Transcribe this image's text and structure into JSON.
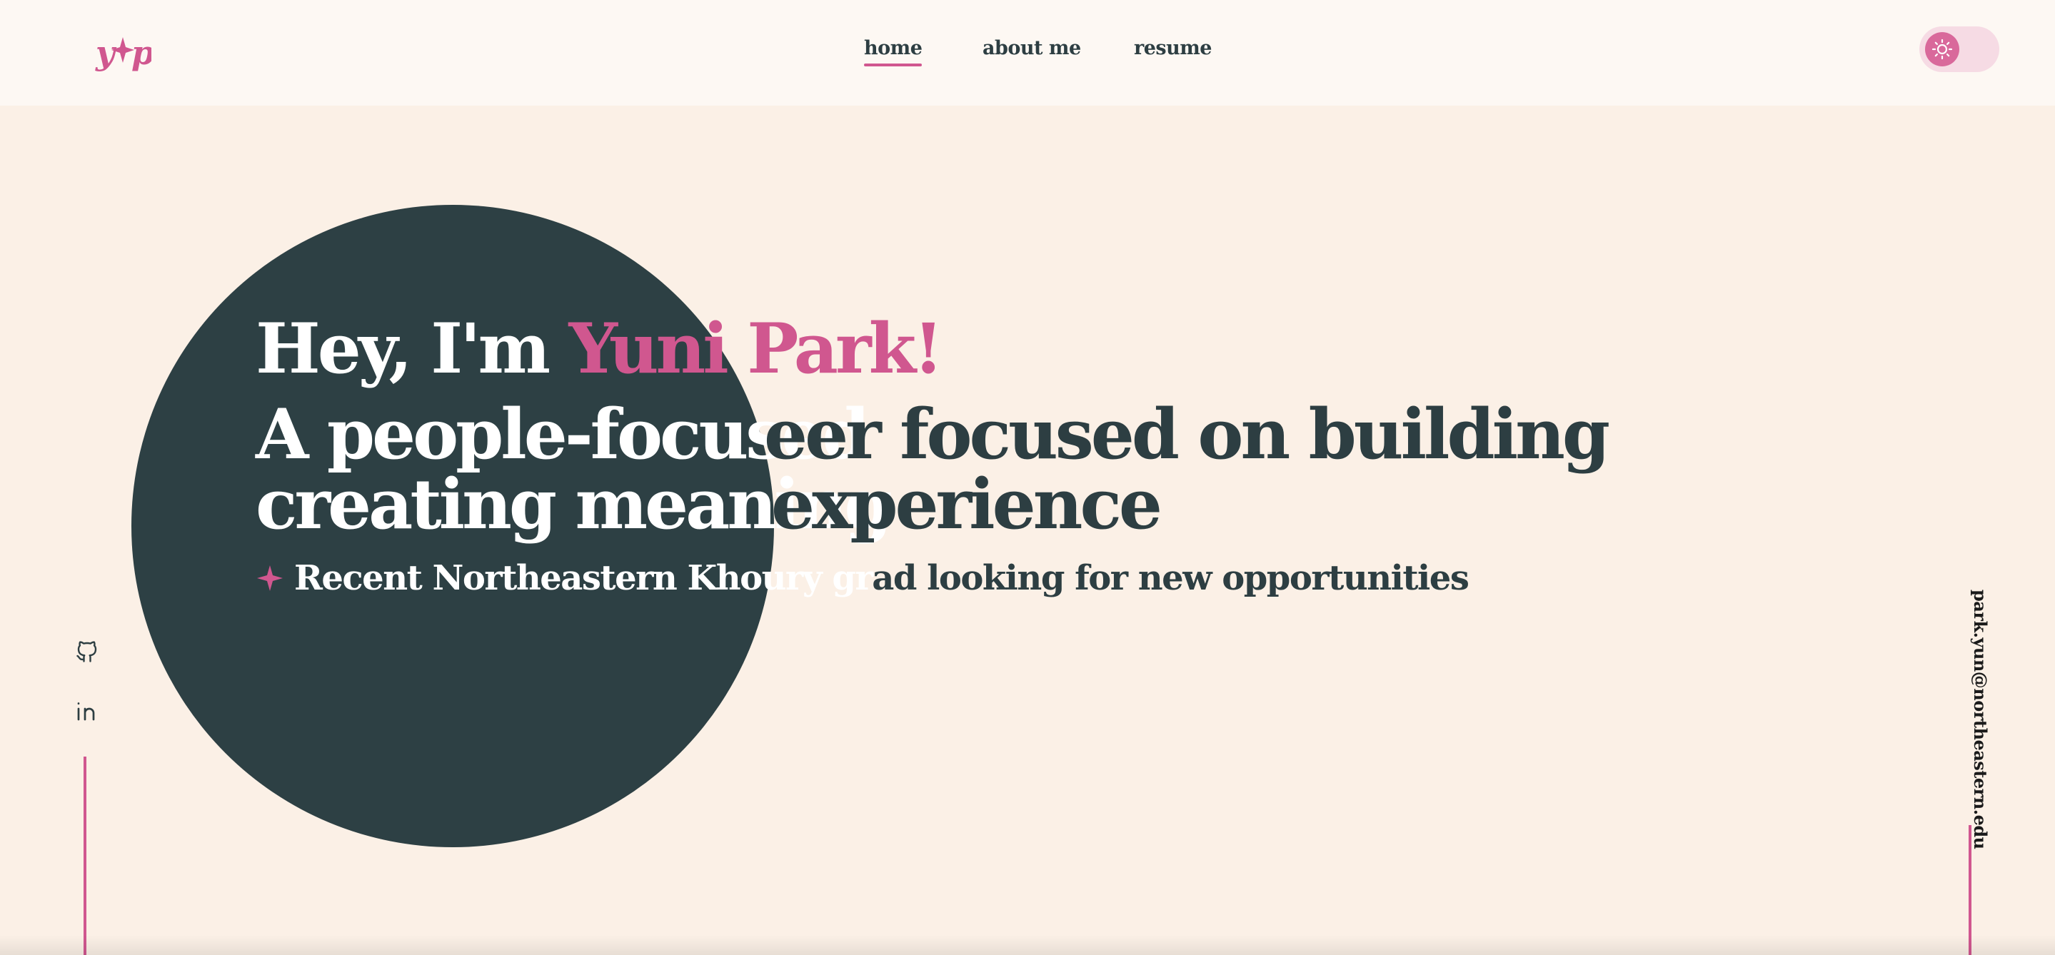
{
  "header": {
    "logo_text": "y✦p",
    "nav": [
      {
        "label": "home",
        "active": true
      },
      {
        "label": "about me",
        "active": false
      },
      {
        "label": "resume",
        "active": false
      }
    ],
    "theme_toggle": {
      "mode": "light",
      "icon": "sun-icon"
    }
  },
  "hero": {
    "greeting_prefix": "Hey, I'm ",
    "greeting_name": "Yuni Park!",
    "tagline_line1_front": "A people-focused",
    "tagline_line1_back": "eer focused on building",
    "tagline_line2_front": "creating meaning",
    "tagline_line2_back": "experience",
    "subline_front": "Recent Northeastern Khoury gr",
    "subline_back": "ad looking for new opportunities",
    "sparkle_icon": "sparkle-icon"
  },
  "social": {
    "github_icon": "github-icon",
    "linkedin_icon": "linkedin-icon"
  },
  "contact": {
    "email": "park.yun@northeastern.edu"
  },
  "colors": {
    "accent": "#d0578f",
    "dark": "#2d4044",
    "background": "#fbf0e6",
    "header_bg": "#fdf8f3"
  }
}
